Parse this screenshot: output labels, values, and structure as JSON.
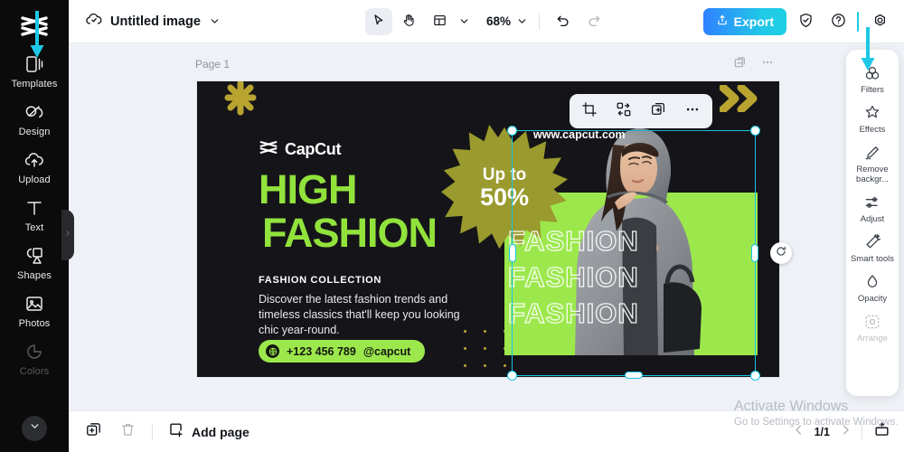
{
  "left_rail": {
    "logo_icon": "capcut-logo",
    "items": [
      {
        "label": "Templates",
        "icon": "templates-icon"
      },
      {
        "label": "Design",
        "icon": "design-icon"
      },
      {
        "label": "Upload",
        "icon": "upload-cloud-icon"
      },
      {
        "label": "Text",
        "icon": "text-icon"
      },
      {
        "label": "Shapes",
        "icon": "shapes-icon"
      },
      {
        "label": "Photos",
        "icon": "photos-icon"
      },
      {
        "label": "Colors",
        "icon": "colors-icon"
      }
    ],
    "more_icon": "chevron-down-icon",
    "collapse_icon": "chevron-right-icon"
  },
  "topbar": {
    "cloud_icon": "cloud-saved-icon",
    "title": "Untitled image",
    "title_chevron": "chevron-down-icon",
    "select_tool_icon": "cursor-select-icon",
    "hand_tool_icon": "hand-pan-icon",
    "layout_icon": "layout-grid-icon",
    "layout_chevron": "chevron-down-icon",
    "zoom_level": "68%",
    "zoom_chevron": "chevron-down-icon",
    "undo_icon": "undo-icon",
    "redo_icon": "redo-icon",
    "export_label": "Export",
    "export_icon": "upload-share-icon",
    "shield_icon": "shield-check-icon",
    "help_icon": "help-circle-icon",
    "settings_icon": "gear-icon",
    "accent_color": "#1ec8e6"
  },
  "workspace": {
    "page_label": "Page 1",
    "duplicate_page_icon": "duplicate-page-icon",
    "page_more_icon": "more-horizontal-icon"
  },
  "float_toolbar": {
    "crop_icon": "crop-icon",
    "flip_icon": "flip-rotate-icon",
    "duplicate_icon": "duplicate-icon",
    "more_icon": "more-horizontal-icon"
  },
  "selection": {
    "rotate_icon": "rotate-icon"
  },
  "design": {
    "brand": "CapCut",
    "brand_icon": "capcut-logo",
    "headline_line1": "HIGH",
    "headline_line2": "FASHION",
    "subheading": "FASHION COLLECTION",
    "body": "Discover the latest fashion trends and timeless classics that'll keep you looking chic year-round.",
    "phone": "+123 456 789",
    "handle": "@capcut",
    "pill_icon": "globe-icon",
    "badge_line1": "Up to",
    "badge_line2": "50%",
    "website": "www.capcut.com",
    "watermark_text": [
      "FASHION",
      "FASHION",
      "FASHION"
    ],
    "colors": {
      "background": "#151519",
      "accent_green": "#92e23c",
      "pill_green": "#9ce84c",
      "gold": "#b9a430",
      "burst": "#9a9a2e",
      "text_white": "#ffffff"
    }
  },
  "right_panel": {
    "items": [
      {
        "label": "Filters",
        "icon": "filters-icon",
        "faded": false
      },
      {
        "label": "Effects",
        "icon": "effects-icon",
        "faded": false
      },
      {
        "label": "Remove backgr...",
        "icon": "remove-background-icon",
        "faded": false
      },
      {
        "label": "Adjust",
        "icon": "adjust-sliders-icon",
        "faded": false
      },
      {
        "label": "Smart tools",
        "icon": "smart-tools-icon",
        "faded": false
      },
      {
        "label": "Opacity",
        "icon": "opacity-icon",
        "faded": false
      },
      {
        "label": "Arrange",
        "icon": "arrange-icon",
        "faded": true
      }
    ]
  },
  "bottombar": {
    "duplicate_icon": "duplicate-page-icon",
    "delete_icon": "trash-icon",
    "add_page_label": "Add page",
    "add_page_icon": "add-page-icon",
    "prev_icon": "chevron-left-icon",
    "next_icon": "chevron-right-icon",
    "page_indicator": "1/1",
    "present_icon": "present-icon"
  },
  "watermark": {
    "line1": "Activate Windows",
    "line2": "Go to Settings to activate Windows."
  },
  "annotations": {
    "arrow_color": "#1ec8e6",
    "left_arrow_icon": "down-arrow-annotation",
    "right_arrow_icon": "down-arrow-annotation"
  }
}
